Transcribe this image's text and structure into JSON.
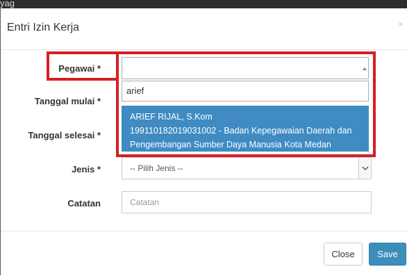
{
  "background": {
    "fragment_text": "yag"
  },
  "modal": {
    "title": "Entri Izin Kerja",
    "close_symbol": "×"
  },
  "form": {
    "pegawai": {
      "label": "Pegawai",
      "required_mark": "*",
      "search_value": "arief",
      "result": {
        "line1": "ARIEF RIJAL, S.Kom",
        "line2": "199110182019031002 - Badan Kepegawaian Daerah dan",
        "line3": "Pengembangan Sumber Daya Manusia Kota Medan"
      }
    },
    "tanggal_mulai": {
      "label": "Tanggal mulai",
      "required_mark": "*"
    },
    "tanggal_selesai": {
      "label": "Tanggal selesai",
      "required_mark": "*"
    },
    "jenis": {
      "label": "Jenis",
      "required_mark": "*",
      "selected": "-- Pilih Jenis --"
    },
    "catatan": {
      "label": "Catatan",
      "placeholder": "Catatan"
    }
  },
  "footer": {
    "close_label": "Close",
    "save_label": "Save"
  },
  "colors": {
    "highlight_red": "#d51f26",
    "result_blue": "#3f8bc2",
    "save_blue": "#3c8dbc"
  },
  "icons": {
    "close": "close-icon",
    "select_caret": "caret-up-icon",
    "dropdown_chevron": "chevron-down-icon"
  }
}
